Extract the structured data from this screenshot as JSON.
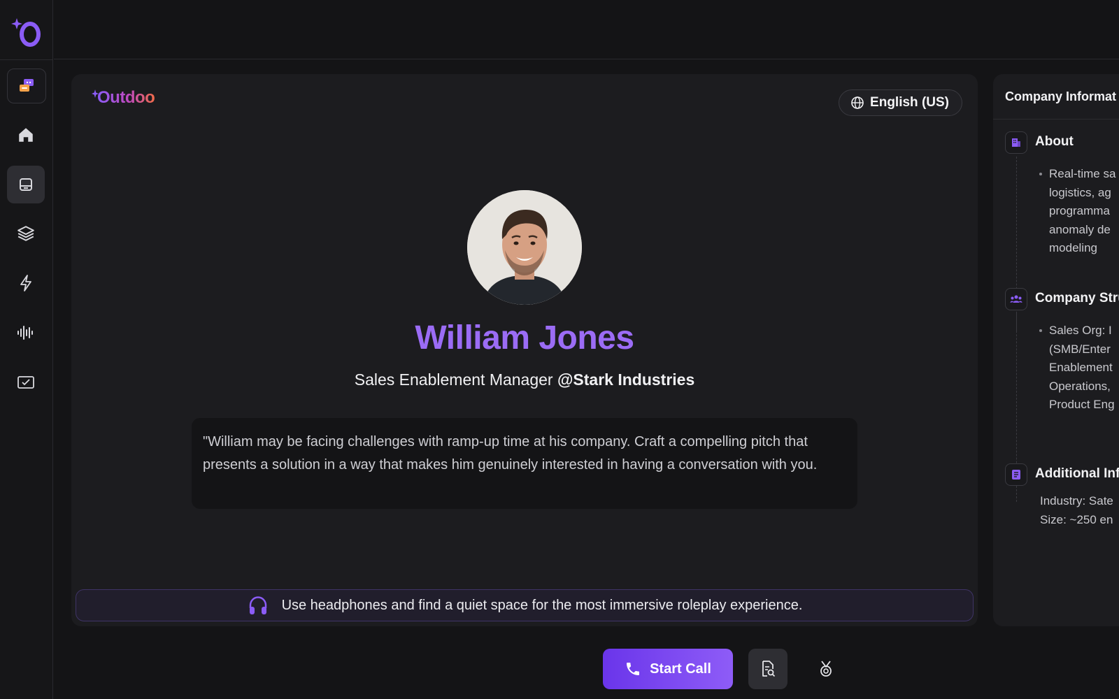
{
  "app": {
    "rail_logo_glyph": "O",
    "brand_name": "Outdoo"
  },
  "rail": {
    "items": [
      {
        "name": "roleplay-icon"
      },
      {
        "name": "home-icon"
      },
      {
        "name": "inbox-icon"
      },
      {
        "name": "layers-icon"
      },
      {
        "name": "lightning-icon"
      },
      {
        "name": "waveform-icon"
      },
      {
        "name": "checked-screen-icon"
      }
    ],
    "active_index": 2
  },
  "language": {
    "label": "English (US)",
    "icon": "globe-icon"
  },
  "persona": {
    "name": "William Jones",
    "role": "Sales Enablement Manager",
    "company": "@Stark Industries",
    "prompt": "\"William may be facing challenges with ramp-up time at his company. Craft a compelling pitch that presents a solution in a way that makes him genuinely interested in having a conversation with you."
  },
  "tip": {
    "icon": "headphones-icon",
    "text": "Use headphones and find a quiet space for the most immersive roleplay experience."
  },
  "side_panel": {
    "title": "Company Informat",
    "sections": [
      {
        "icon": "building-icon",
        "title": "About",
        "lines": [
          "Real-time sa",
          "logistics, ag",
          "programma",
          "anomaly de",
          "modeling"
        ]
      },
      {
        "icon": "team-icon",
        "title": "Company Stru",
        "lines": [
          "Sales Org: I",
          "(SMB/Enter",
          "Enablement",
          "Operations,",
          "Product Eng"
        ]
      },
      {
        "icon": "note-icon",
        "title": "Additional Inf",
        "lines": [
          "Industry: Sate",
          "Size: ~250 en"
        ]
      }
    ]
  },
  "actions": {
    "start_call_label": "Start Call",
    "start_call_icon": "phone-icon",
    "doc_icon": "document-search-icon",
    "extra_icon": "award-icon"
  },
  "colors": {
    "accent": "#8b5cf6",
    "name_color": "#9b6cf5",
    "background": "#141416",
    "card": "#1c1c1f"
  }
}
